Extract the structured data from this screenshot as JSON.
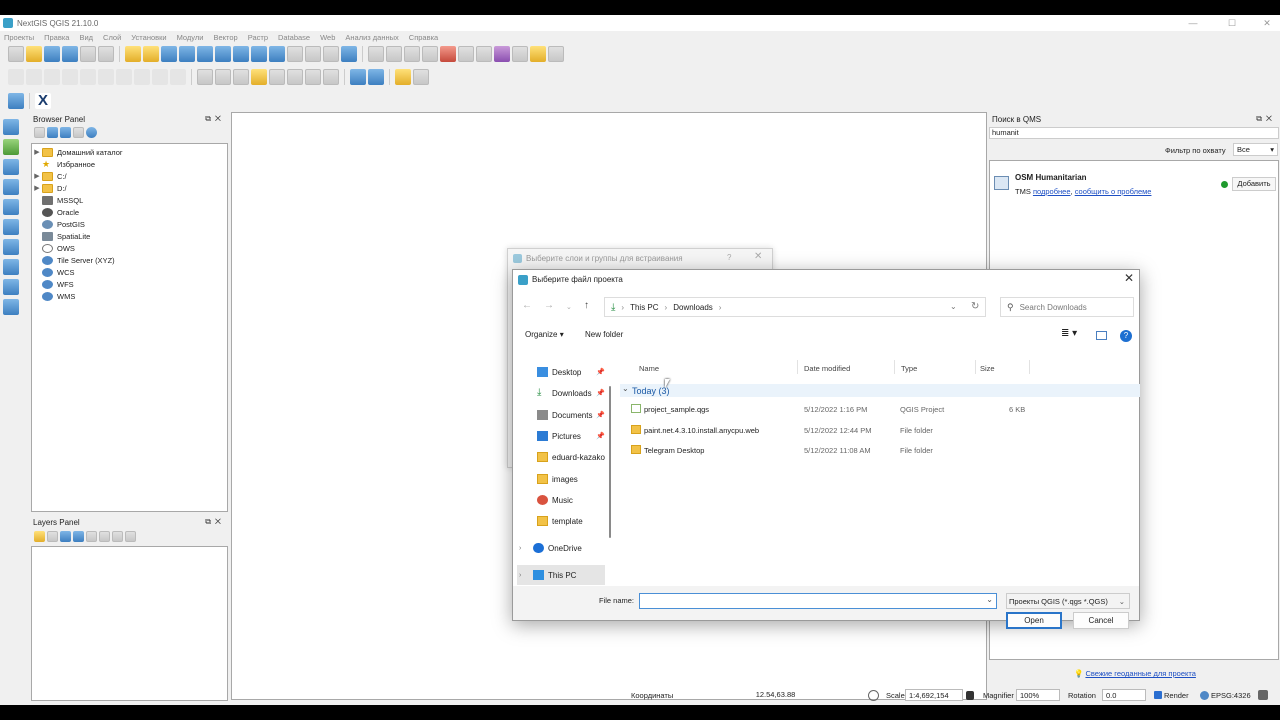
{
  "window": {
    "title": "NextGIS QGIS 21.10.0"
  },
  "menu": [
    "Проекты",
    "Правка",
    "Вид",
    "Слой",
    "Установки",
    "Модули",
    "Вектор",
    "Растр",
    "Database",
    "Web",
    "Анализ данных",
    "Справка"
  ],
  "browser_panel": {
    "title": "Browser Panel",
    "items": [
      "Домашний каталог",
      "Избранное",
      "C:/",
      "D:/",
      "MSSQL",
      "Oracle",
      "PostGIS",
      "SpatiaLite",
      "OWS",
      "Tile Server (XYZ)",
      "WCS",
      "WFS",
      "WMS"
    ]
  },
  "layers_panel": {
    "title": "Layers Panel"
  },
  "qms": {
    "title": "Поиск в QMS",
    "search_value": "humanit",
    "filter_label": "Фильтр по охвату",
    "filter_value": "Все",
    "result_name": "OSM Humanitarian",
    "result_type": "TMS",
    "link_more": "подробнее",
    "comma": ",",
    "link_report": "сообщить о проблеме",
    "add_button": "Добавить",
    "footer_link": "Свежие геоданные для проекта"
  },
  "status": {
    "coords_label": "Координаты",
    "coords_value": "12.54,63.88",
    "scale_label": "Scale",
    "scale_value": "1:4,692,154",
    "magnifier_label": "Magnifier",
    "magnifier_value": "100%",
    "rotation_label": "Rotation",
    "rotation_value": "0.0",
    "render_label": "Render",
    "crs": "EPSG:4326"
  },
  "behind_dialog": {
    "title": "Выберите слои и группы для встраивания",
    "help": "?"
  },
  "file_dialog": {
    "title": "Выберите файл проекта",
    "breadcrumb": [
      "This PC",
      "Downloads"
    ],
    "search_placeholder": "Search Downloads",
    "organize": "Organize",
    "new_folder": "New folder",
    "nav": [
      "Desktop",
      "Downloads",
      "Documents",
      "Pictures",
      "eduard-kazakov",
      "images",
      "Music",
      "template",
      "OneDrive",
      "This PC"
    ],
    "columns": [
      "Name",
      "Date modified",
      "Type",
      "Size"
    ],
    "group": "Today (3)",
    "files": [
      {
        "name": "project_sample.qgs",
        "date": "5/12/2022 1:16 PM",
        "type": "QGIS Project",
        "size": "6 KB"
      },
      {
        "name": "paint.net.4.3.10.install.anycpu.web",
        "date": "5/12/2022 12:44 PM",
        "type": "File folder",
        "size": ""
      },
      {
        "name": "Telegram Desktop",
        "date": "5/12/2022 11:08 AM",
        "type": "File folder",
        "size": ""
      }
    ],
    "file_name_label": "File name:",
    "file_name_value": "",
    "filter": "Проекты QGIS (*.qgs *.QGS)",
    "open": "Open",
    "cancel": "Cancel"
  }
}
